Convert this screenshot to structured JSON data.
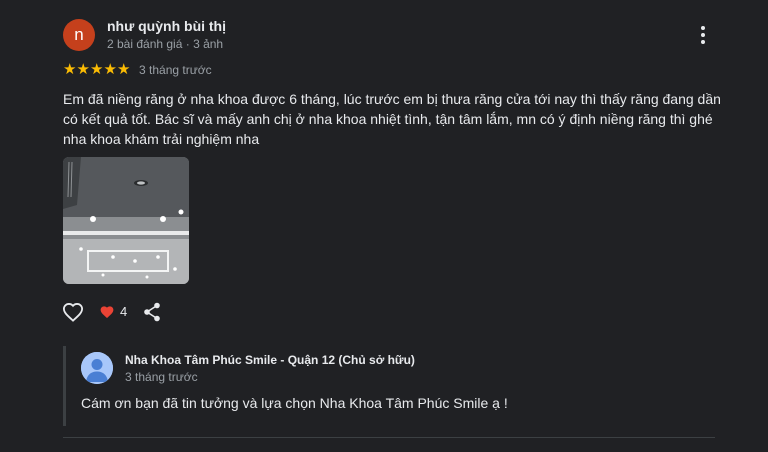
{
  "review": {
    "author": {
      "initial": "n",
      "name": "như quỳnh bùi thị",
      "meta": "2 bài đánh giá · 3 ảnh",
      "avatar_color": "#c5401c"
    },
    "rating": 5,
    "star_color": "#fbbc04",
    "date": "3 tháng trước",
    "text": "Em đã niềng răng ở nha khoa được 6 tháng, lúc trước em bị thưa răng cửa tới nay thì thấy răng đang dần có kết quả tốt. Bác sĩ và mấy anh chị ở nha khoa nhiệt tình, tận tâm lắm, mn có ý định niềng răng thì ghé nha khoa khám trải nghiệm nha",
    "photo_icon": "clinic-ceiling-photo",
    "actions": {
      "like_icon": "heart-outline-icon",
      "like_count_icon": "heart-filled-icon",
      "like_count": "4",
      "share_icon": "share-icon",
      "more_icon": "more-vert-icon",
      "heart_color": "#ea4335"
    }
  },
  "owner_reply": {
    "name": "Nha Khoa Tâm Phúc Smile - Quận 12 (Chủ sở hữu)",
    "date": "3 tháng trước",
    "text": "Cám ơn bạn đã tin tưởng và lựa chọn Nha Khoa Tâm Phúc Smile ạ !",
    "avatar_icon": "default-person-avatar"
  }
}
